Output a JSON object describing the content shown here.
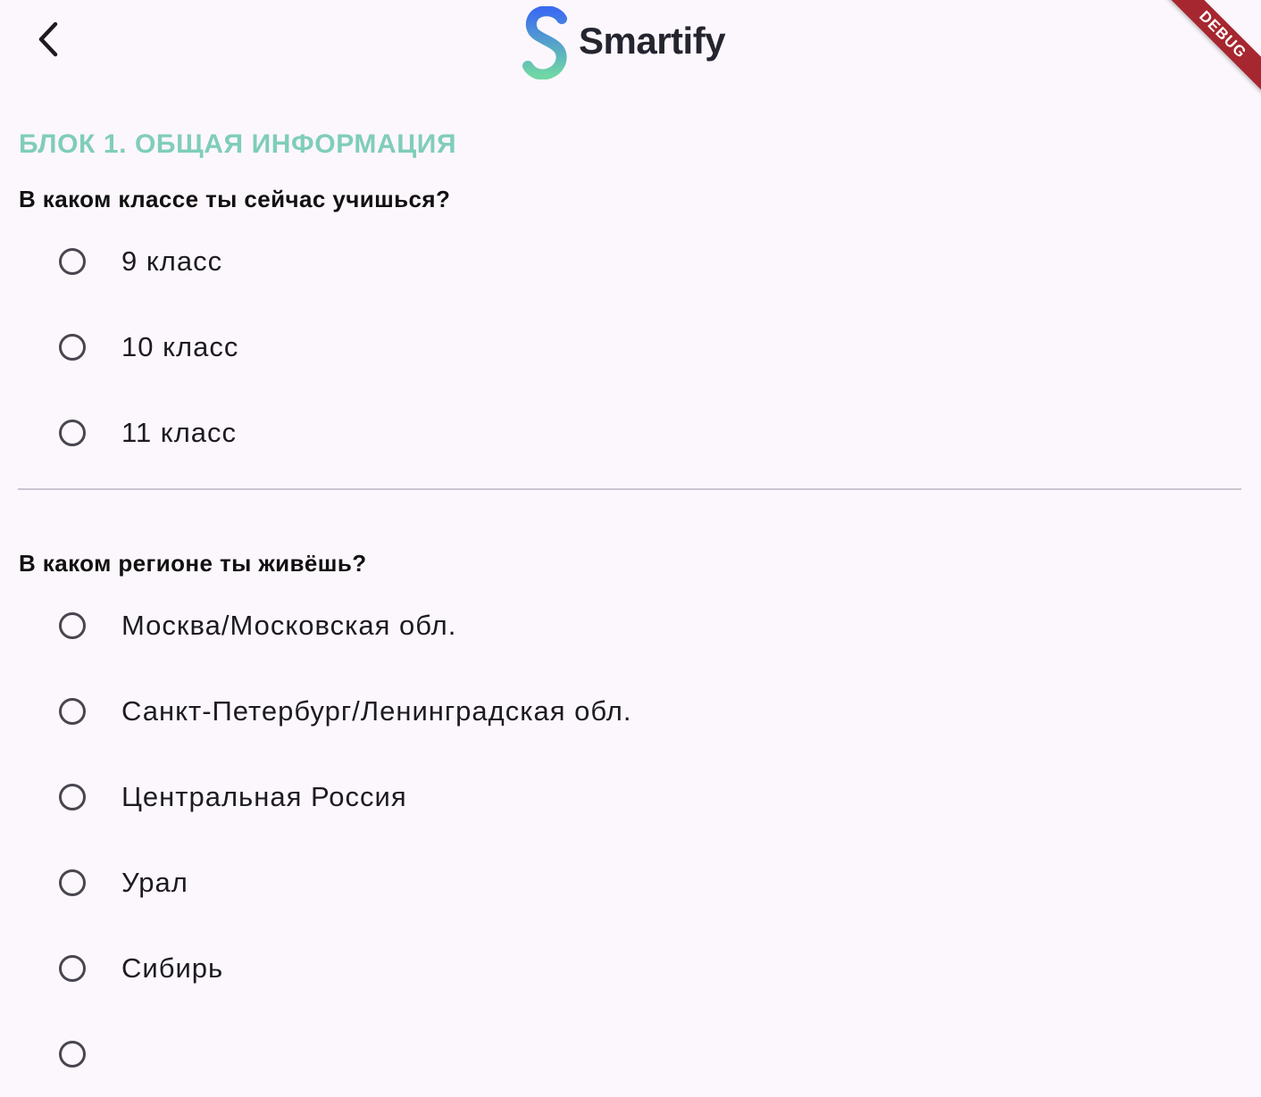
{
  "header": {
    "back_icon": "chevron-left-icon",
    "logo_text": "Smartify",
    "logo_colors": {
      "top": "#3b6cf0",
      "bottom": "#6fd6a6"
    }
  },
  "debug_banner": {
    "label": "DEBUG",
    "color": "#a6272f"
  },
  "block": {
    "title": "БЛОК 1. ОБЩАЯ ИНФОРМАЦИЯ",
    "accent_color": "#7fcdbb"
  },
  "questions": [
    {
      "text": "В каком классе ты сейчас учишься?",
      "options": [
        "9 класс",
        "10 класс",
        "11 класс"
      ]
    },
    {
      "text": "В каком регионе ты живёшь?",
      "options": [
        "Москва/Московская обл.",
        "Санкт-Петербург/Ленинградская обл.",
        "Центральная Россия",
        "Урал",
        "Сибирь"
      ]
    }
  ]
}
